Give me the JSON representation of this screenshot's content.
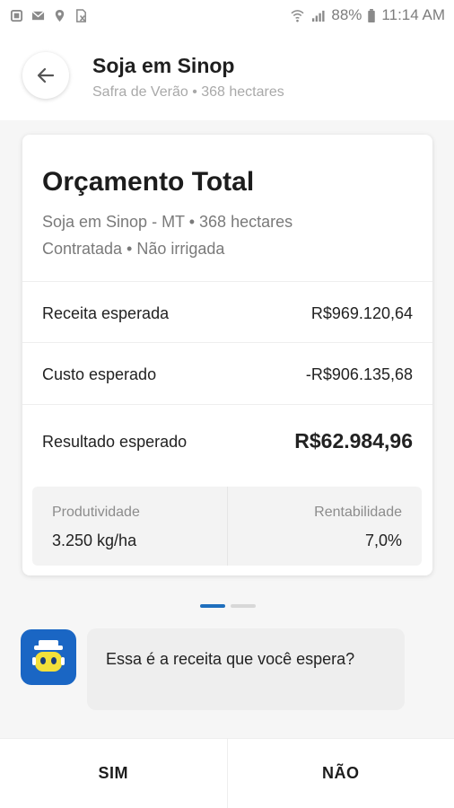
{
  "status_bar": {
    "battery": "88%",
    "time": "11:14 AM",
    "icons": [
      "notification-icon",
      "mail-icon",
      "location-icon",
      "no-sim-icon",
      "wifi-icon",
      "signal-icon",
      "battery-icon"
    ]
  },
  "header": {
    "title": "Soja em Sinop",
    "subtitle": "Safra de Verão • 368 hectares",
    "back_icon": "arrow-left-icon"
  },
  "card": {
    "title": "Orçamento Total",
    "line1": "Soja em Sinop - MT • 368 hectares",
    "line2": "Contratada • Não irrigada",
    "rows": [
      {
        "label": "Receita esperada",
        "value": "R$969.120,64"
      },
      {
        "label": "Custo esperado",
        "value": "-R$906.135,68"
      },
      {
        "label": "Resultado esperado",
        "value": "R$62.984,96"
      }
    ],
    "stats": [
      {
        "label": "Produtividade",
        "value": "3.250 kg/ha"
      },
      {
        "label": "Rentabilidade",
        "value": "7,0%"
      }
    ]
  },
  "pager": {
    "total": 2,
    "active": 1
  },
  "chat": {
    "avatar_icon": "robot-assistant-icon",
    "message": "Essa é a receita que você espera?"
  },
  "actions": {
    "yes_label": "SIM",
    "no_label": "NÃO"
  },
  "colors": {
    "accent": "#1f6fbd",
    "avatar_bg": "#1a66c4"
  }
}
